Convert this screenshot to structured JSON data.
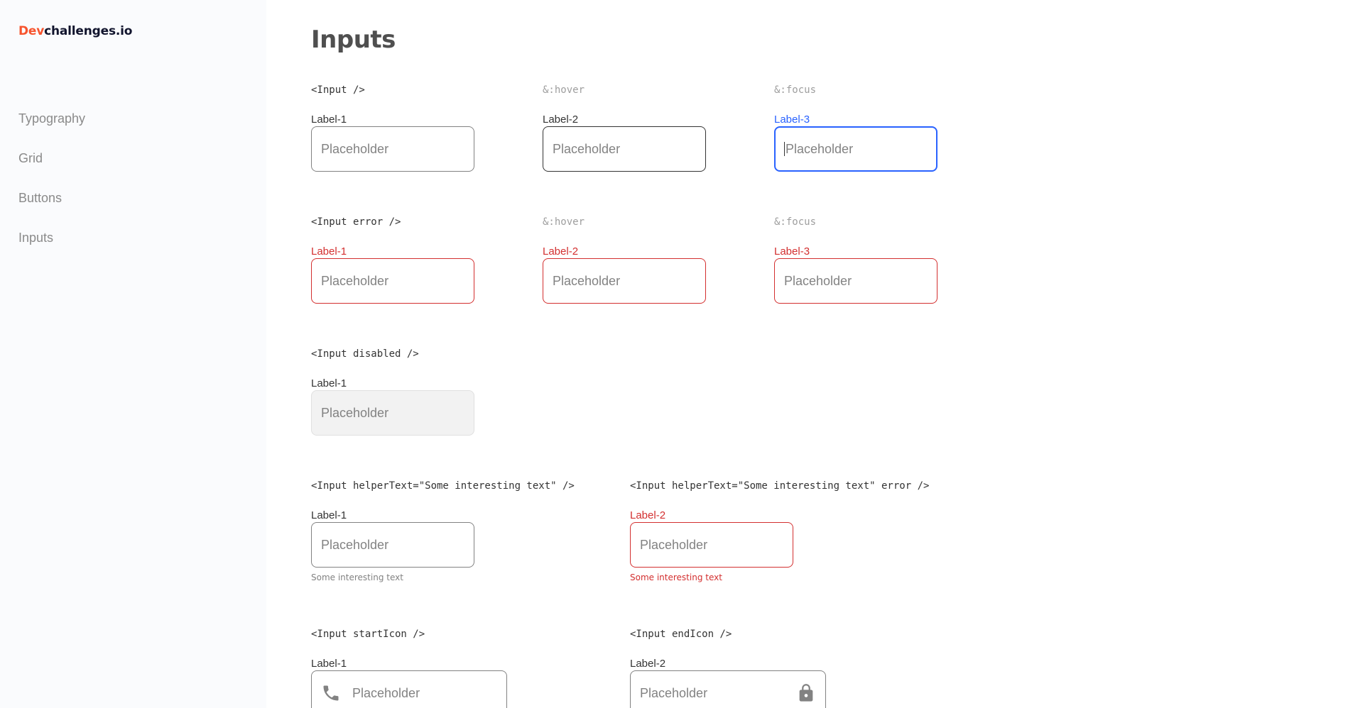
{
  "sidebar": {
    "logo": {
      "brand": "Dev",
      "rest": "challenges.io"
    },
    "items": [
      {
        "label": "Typography"
      },
      {
        "label": "Grid"
      },
      {
        "label": "Buttons"
      },
      {
        "label": "Inputs"
      }
    ]
  },
  "main": {
    "title": "Inputs",
    "placeholder": "Placeholder",
    "rows": {
      "default": {
        "headers": [
          "<Input />",
          "&:hover",
          "&:focus"
        ],
        "labels": [
          "Label-1",
          "Label-2",
          "Label-3"
        ]
      },
      "error": {
        "headers": [
          "<Input error />",
          "&:hover",
          "&:focus"
        ],
        "labels": [
          "Label-1",
          "Label-2",
          "Label-3"
        ]
      },
      "disabled": {
        "header": "<Input disabled />",
        "label": "Label-1"
      },
      "helper": {
        "headers": [
          "<Input helperText=\"Some interesting text\" />",
          "<Input helperText=\"Some interesting text\" error />"
        ],
        "labels": [
          "Label-1",
          "Label-2"
        ],
        "helper_text": "Some interesting text"
      },
      "icons": {
        "headers": [
          "<Input startIcon />",
          "<Input endIcon />"
        ],
        "labels": [
          "Label-1",
          "Label-2"
        ],
        "start_icon": "phone-icon",
        "end_icon": "lock-icon"
      }
    }
  },
  "colors": {
    "brand": "#f7542e",
    "error": "#d32f2f",
    "focus": "#2962ff",
    "border": "#828282",
    "disabled_bg": "#f2f2f2"
  }
}
